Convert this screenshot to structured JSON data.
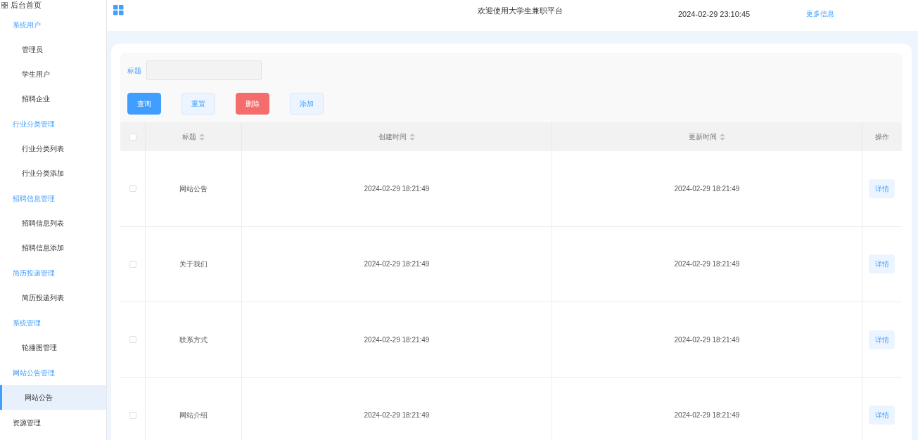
{
  "sidebar": {
    "home": "后台首页",
    "groups": [
      {
        "label": "系统用户",
        "children": [
          {
            "label": "管理员",
            "selected": false
          },
          {
            "label": "学生用户",
            "selected": false
          },
          {
            "label": "招聘企业",
            "selected": false
          }
        ]
      },
      {
        "label": "行业分类管理",
        "children": [
          {
            "label": "行业分类列表",
            "selected": false
          },
          {
            "label": "行业分类添加",
            "selected": false
          }
        ]
      },
      {
        "label": "招聘信息管理",
        "children": [
          {
            "label": "招聘信息列表",
            "selected": false
          },
          {
            "label": "招聘信息添加",
            "selected": false
          }
        ]
      },
      {
        "label": "简历投递管理",
        "children": [
          {
            "label": "简历投递列表",
            "selected": false
          }
        ]
      },
      {
        "label": "系统管理",
        "children": [
          {
            "label": "轮播图管理",
            "selected": false
          }
        ]
      },
      {
        "label": "网站公告管理",
        "children": [
          {
            "label": "网站公告",
            "selected": true
          }
        ]
      }
    ],
    "last": "资源管理"
  },
  "header": {
    "title": "欢迎使用大学生兼职平台",
    "datetime": "2024-02-29 23:10:45",
    "link": "更多信息"
  },
  "search": {
    "label": "标题",
    "buttons": [
      {
        "label": "查询",
        "kind": "primary"
      },
      {
        "label": "重置",
        "kind": "plain"
      },
      {
        "label": "删除",
        "kind": "danger"
      },
      {
        "label": "添加",
        "kind": "plain"
      }
    ]
  },
  "table": {
    "all_checked": false,
    "columns": [
      "标题",
      "创建时间",
      "更新时间",
      "操作"
    ],
    "rows": [
      {
        "checked": false,
        "title": "网站公告",
        "created": "2024-02-29 18:21:49",
        "updated": "2024-02-29 18:21:49",
        "action": "详情"
      },
      {
        "checked": false,
        "title": "关于我们",
        "created": "2024-02-29 18:21:49",
        "updated": "2024-02-29 18:21:49",
        "action": "详情"
      },
      {
        "checked": false,
        "title": "联系方式",
        "created": "2024-02-29 18:21:49",
        "updated": "2024-02-29 18:21:49",
        "action": "详情"
      },
      {
        "checked": false,
        "title": "网站介绍",
        "created": "2024-02-29 18:21:49",
        "updated": "2024-02-29 18:21:49",
        "action": "详情"
      }
    ]
  }
}
